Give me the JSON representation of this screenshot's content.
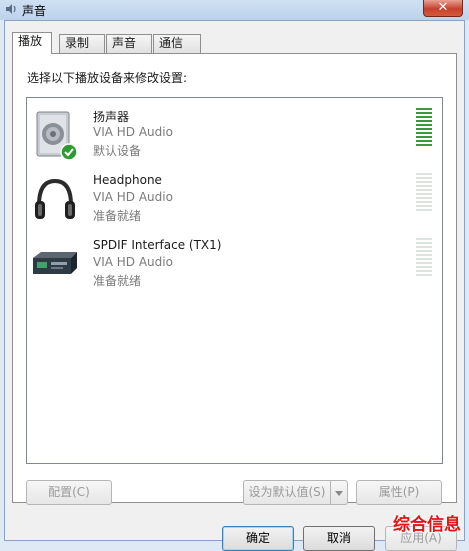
{
  "window": {
    "title": "声音",
    "close_glyph": "✕"
  },
  "tabs": [
    {
      "label": "播放",
      "active": true
    },
    {
      "label": "录制",
      "active": false
    },
    {
      "label": "声音",
      "active": false
    },
    {
      "label": "通信",
      "active": false
    }
  ],
  "instruction": "选择以下播放设备来修改设置:",
  "devices": [
    {
      "name": "扬声器",
      "driver": "VIA HD Audio",
      "status": "默认设备",
      "icon": "speaker-icon",
      "default": true,
      "level_active": true
    },
    {
      "name": "Headphone",
      "driver": "VIA HD Audio",
      "status": "准备就绪",
      "icon": "headphone-icon",
      "default": false,
      "level_active": false
    },
    {
      "name": "SPDIF Interface (TX1)",
      "driver": "VIA HD Audio",
      "status": "准备就绪",
      "icon": "spdif-device-icon",
      "default": false,
      "level_active": false
    }
  ],
  "buttons": {
    "configure": "配置(C)",
    "set_default": "设为默认值(S)",
    "properties": "属性(P)",
    "ok": "确定",
    "cancel": "取消",
    "apply": "应用(A)"
  },
  "watermark": "综合信息",
  "colors": {
    "meter_active": "#3a9a3a",
    "meter_inactive": "#dde3de",
    "default_check": "#2f9b2f",
    "close_button": "#c6412c"
  }
}
